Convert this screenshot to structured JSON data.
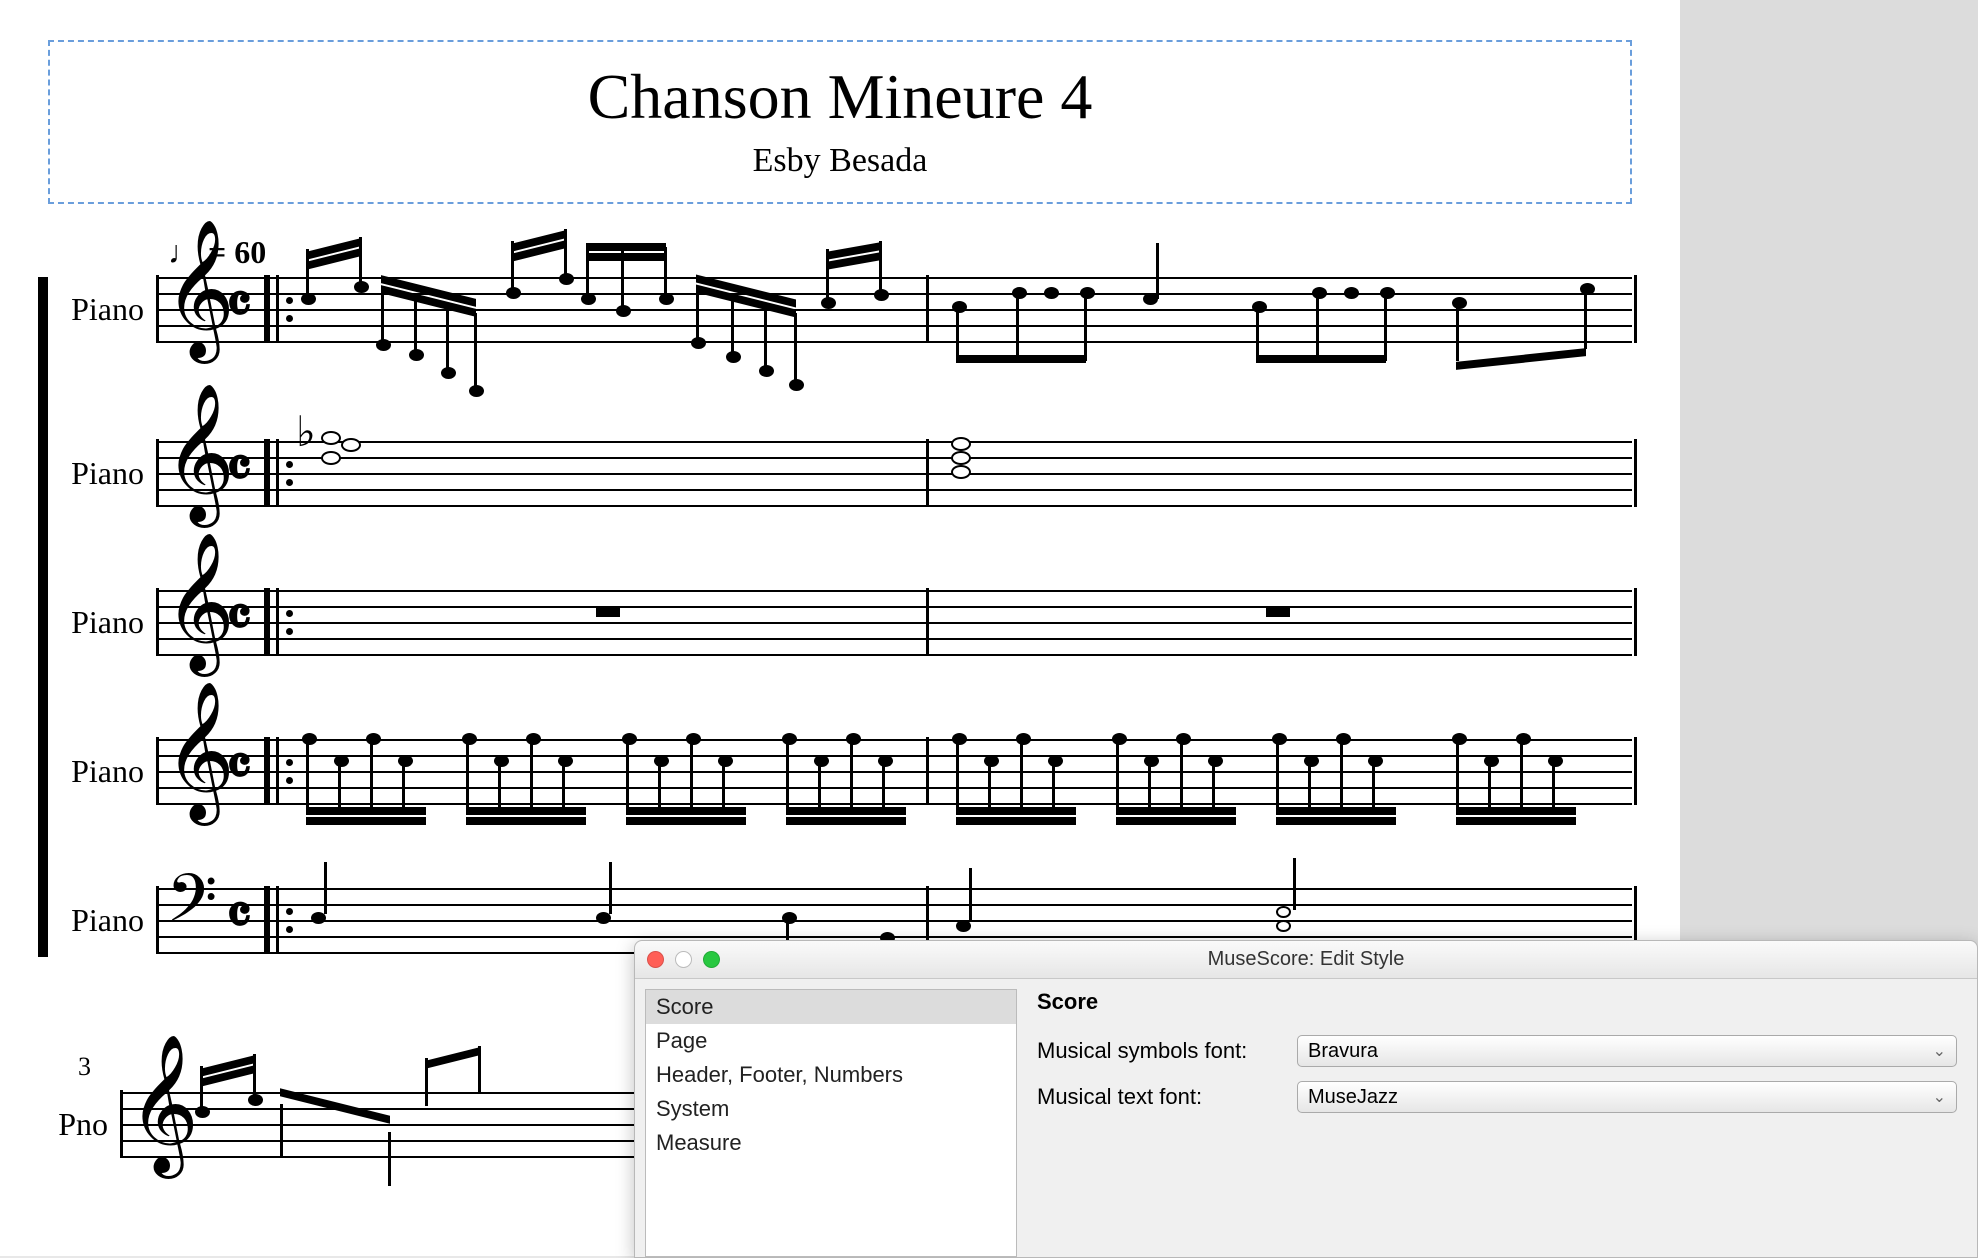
{
  "score": {
    "title": "Chanson Mineure 4",
    "composer": "Esby Besada",
    "tempo_marking": "♩ = 60",
    "measure_num_system2": "3",
    "staves": [
      {
        "label": "Piano",
        "clef": "treble"
      },
      {
        "label": "Piano",
        "clef": "treble"
      },
      {
        "label": "Piano",
        "clef": "treble"
      },
      {
        "label": "Piano",
        "clef": "treble"
      },
      {
        "label": "Piano",
        "clef": "bass"
      }
    ],
    "staves_system2": [
      {
        "label": "Pno"
      }
    ]
  },
  "dialog": {
    "window_title": "MuseScore: Edit Style",
    "categories": [
      "Score",
      "Page",
      "Header, Footer, Numbers",
      "System",
      "Measure"
    ],
    "selected_category": "Score",
    "panel_title": "Score",
    "form": {
      "symbols_label": "Musical symbols font:",
      "symbols_value": "Bravura",
      "text_label": "Musical text font:",
      "text_value": "MuseJazz"
    }
  }
}
